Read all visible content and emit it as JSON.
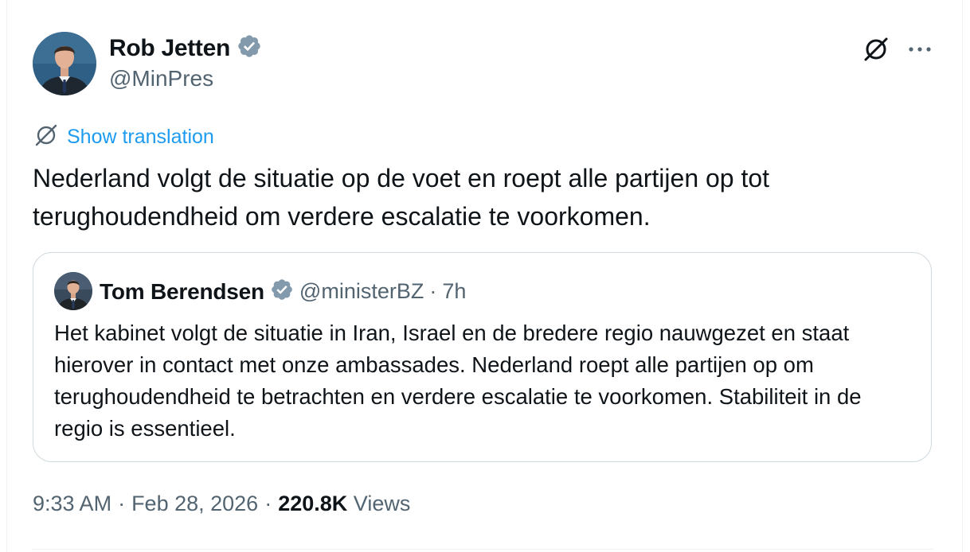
{
  "author": {
    "display_name": "Rob Jetten",
    "handle": "@MinPres",
    "verified_badge": "verified-badge-icon",
    "badge_color": "#829aab"
  },
  "header_actions": {
    "grok_icon": "grok-icon",
    "more_icon": "more-icon"
  },
  "translation": {
    "label": "Show translation",
    "icon": "translate-icon"
  },
  "tweet": {
    "text": "Nederland volgt de situatie op de voet en roept alle partijen op tot terughoudendheid om verdere escalatie te voorkomen."
  },
  "quoted_tweet": {
    "display_name": "Tom Berendsen",
    "handle": "@ministerBZ",
    "separator": "·",
    "time": "7h",
    "text": "Het kabinet volgt de situatie in Iran, Israel en de bredere regio nauwgezet en staat hierover in contact met onze ambassades. Nederland roept alle partijen op om terughoudendheid te betrachten en verdere escalatie te voorkomen. Stabiliteit in de regio is essentieel."
  },
  "meta": {
    "time": "9:33 AM",
    "separator": "·",
    "date": "Feb 28, 2026",
    "separator2": "·",
    "views_count": "220.8K",
    "views_label": "Views"
  },
  "colors": {
    "link": "#1d9bf0",
    "secondary_text": "#536471",
    "primary_text": "#0f1419",
    "border": "#cfd9de"
  }
}
